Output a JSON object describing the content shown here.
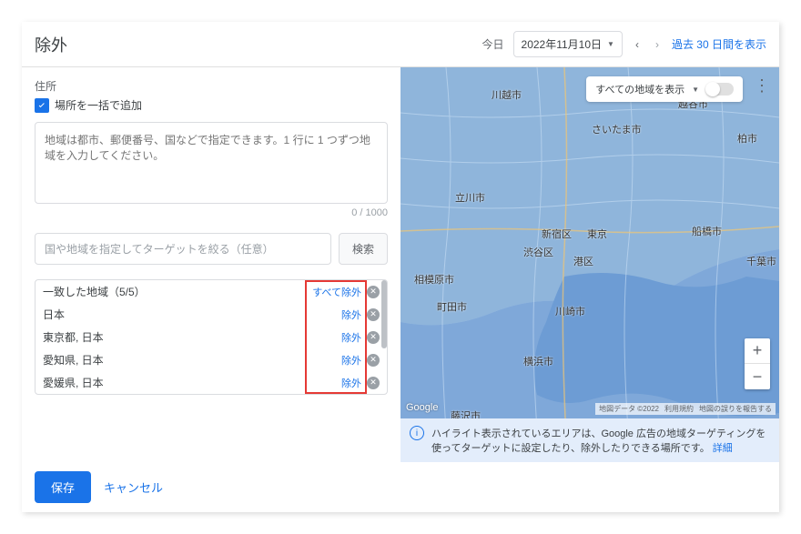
{
  "header": {
    "title": "除外",
    "today_label": "今日",
    "date": "2022年11月10日",
    "show_30_days": "過去 30 日間を表示"
  },
  "left": {
    "section_label": "住所",
    "bulk_add_label": "場所を一括で追加",
    "textarea_placeholder": "地域は都市、郵便番号、国などで指定できます。1 行に 1 つずつ地域を入力してください。",
    "counter": "0 / 1000",
    "search_placeholder": "国や地域を指定してターゲットを絞る（任意）",
    "search_button": "検索",
    "results_header": "一致した地域（5/5）",
    "exclude_all": "すべて除外",
    "exclude": "除外",
    "results": [
      {
        "label": "日本"
      },
      {
        "label": "東京都, 日本"
      },
      {
        "label": "愛知県, 日本"
      },
      {
        "label": "愛媛県, 日本"
      }
    ]
  },
  "map": {
    "dropdown_label": "すべての地域を表示",
    "cities": {
      "kawagoe": "川越市",
      "saitama": "さいたま市",
      "koshigaya": "越谷市",
      "kashiwa": "柏市",
      "tachikawa": "立川市",
      "shinjuku": "新宿区",
      "tokyo": "東京",
      "minato": "港区",
      "funabashi": "船橋市",
      "chiba": "千葉市",
      "shibuya": "渋谷区",
      "machida": "町田市",
      "kawasaki": "川崎市",
      "yokohama": "横浜市",
      "sagamihara": "相模原市",
      "fujisawa": "藤沢市"
    },
    "attribution": {
      "data": "地図データ ©2022",
      "terms": "利用規約",
      "report": "地図の誤りを報告する"
    },
    "google": "Google",
    "info_text": "ハイライト表示されているエリアは、Google 広告の地域ターゲティングを使ってターゲットに設定したり、除外したりできる場所です。",
    "info_link": "詳細"
  },
  "footer": {
    "save": "保存",
    "cancel": "キャンセル"
  }
}
